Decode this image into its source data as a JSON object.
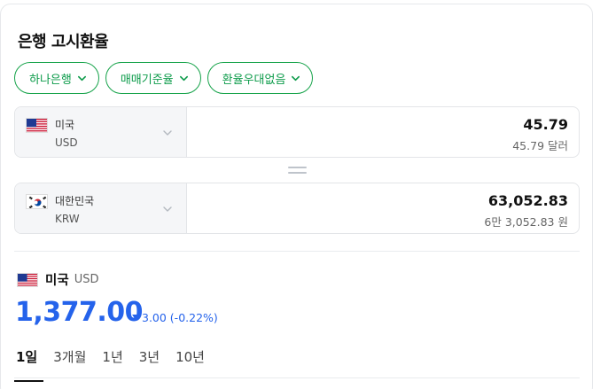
{
  "header": {
    "title": "은행 고시환율"
  },
  "filters": [
    {
      "label": "하나은행"
    },
    {
      "label": "매매기준율"
    },
    {
      "label": "환율우대없음"
    }
  ],
  "converter": {
    "from": {
      "country": "미국",
      "code": "USD",
      "amount": "45.79",
      "amount_text": "45.79 달러",
      "flag": "us-flag-icon"
    },
    "to": {
      "country": "대한민국",
      "code": "KRW",
      "amount": "63,052.83",
      "amount_text": "6만 3,052.83 원",
      "flag": "kr-flag-icon"
    }
  },
  "rate": {
    "country": "미국",
    "code": "USD",
    "value": "1,377.00",
    "change": "3.00 (-0.22%)",
    "direction": "down"
  },
  "tabs": [
    {
      "label": "1일",
      "active": true
    },
    {
      "label": "3개월",
      "active": false
    },
    {
      "label": "1년",
      "active": false
    },
    {
      "label": "3년",
      "active": false
    },
    {
      "label": "10년",
      "active": false
    }
  ],
  "colors": {
    "accent_green": "#0c9b4a",
    "accent_blue": "#2563eb"
  }
}
